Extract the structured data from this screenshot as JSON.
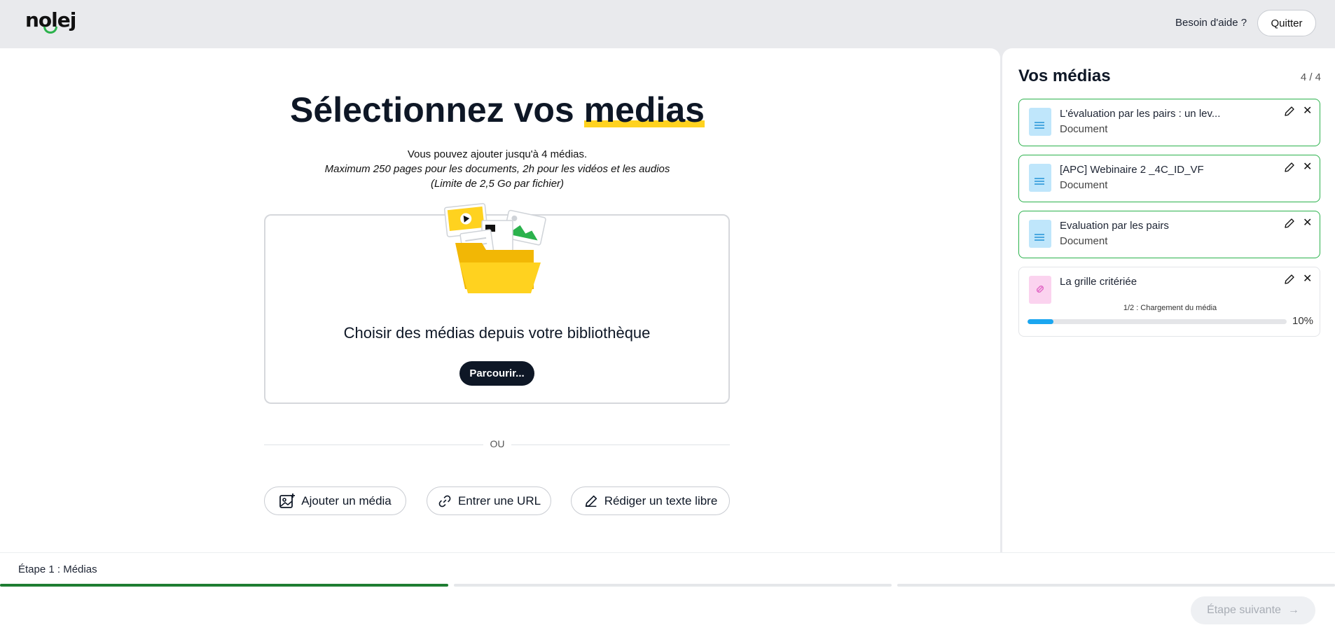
{
  "header": {
    "logo": "nolej",
    "help_label": "Besoin d'aide ?",
    "quit_label": "Quitter"
  },
  "main": {
    "title_prefix": "Sélectionnez vos",
    "title_highlight": "medias",
    "subtitle_line1": "Vous pouvez ajouter jusqu'à 4 médias.",
    "subtitle_line2": "Maximum 250 pages pour les documents, 2h pour les vidéos et les audios",
    "subtitle_line3": "(Limite de 2,5 Go par fichier)",
    "library_text": "Choisir des médias depuis votre bibliothèque",
    "browse_label": "Parcourir...",
    "divider_text": "OU",
    "actions": {
      "add_media": "Ajouter un média",
      "enter_url": "Entrer une URL",
      "free_text": "Rédiger un texte libre"
    }
  },
  "sidebar": {
    "title": "Vos médias",
    "count": "4 / 4",
    "items": [
      {
        "name": "L'évaluation par les pairs : un lev...",
        "type": "Document"
      },
      {
        "name": "[APC] Webinaire 2 _4C_ID_VF",
        "type": "Document"
      },
      {
        "name": "Evaluation par les pairs",
        "type": "Document"
      },
      {
        "name": "La grille critériée",
        "progress_label": "1/2 : Chargement du média",
        "progress_value": 0.1,
        "progress_text": "10%"
      }
    ]
  },
  "footer": {
    "step_label": "Étape 1 : Médias",
    "step_progress": [
      1,
      0,
      0
    ],
    "next_label": "Étape suivante"
  },
  "colors": {
    "accent_green": "#2bb24c",
    "highlight_yellow": "#ffd21f",
    "dark_navy": "#0e1726",
    "progress_blue": "#1aa6f0",
    "step_green": "#1e7d32"
  }
}
